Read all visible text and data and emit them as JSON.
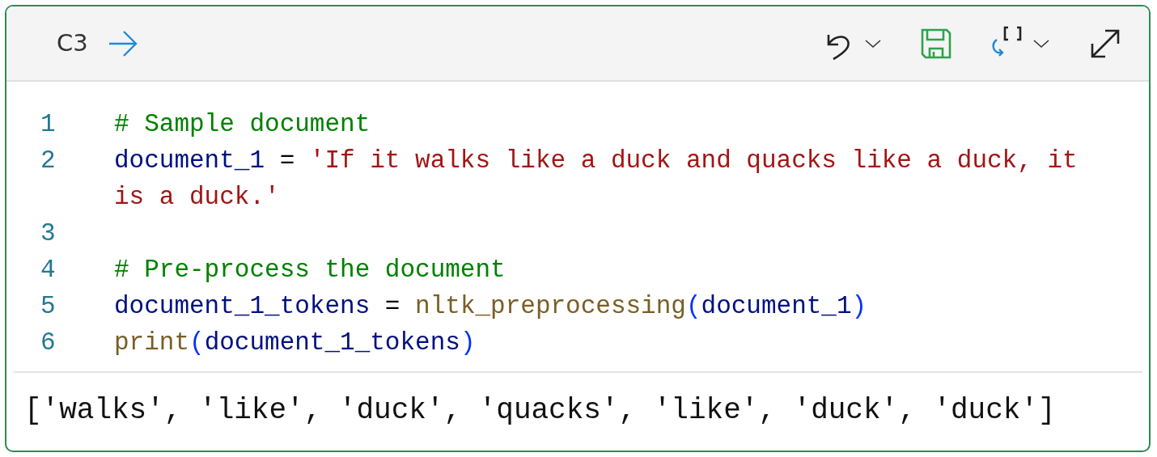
{
  "cell": {
    "label": "C3"
  },
  "code_lines": [
    {
      "number": "1",
      "tokens": [
        {
          "kind": "comment",
          "text": "# Sample document"
        }
      ]
    },
    {
      "number": "2",
      "tokens": [
        {
          "kind": "variable",
          "text": "document_1"
        },
        {
          "kind": "plain",
          "text": " = "
        },
        {
          "kind": "string",
          "text": "'If it walks like a duck and quacks like a duck, it is a duck.'"
        }
      ]
    },
    {
      "number": "3"
    },
    {
      "number": "4",
      "tokens": [
        {
          "kind": "comment",
          "text": "# Pre-process the document"
        }
      ]
    },
    {
      "number": "5",
      "tokens": [
        {
          "kind": "variable",
          "text": "document_1_tokens"
        },
        {
          "kind": "plain",
          "text": " = "
        },
        {
          "kind": "function",
          "text": "nltk_preprocessing"
        },
        {
          "kind": "paren",
          "text": "("
        },
        {
          "kind": "variable",
          "text": "document_1"
        },
        {
          "kind": "paren",
          "text": ")"
        }
      ]
    },
    {
      "number": "6",
      "tokens": [
        {
          "kind": "function",
          "text": "print"
        },
        {
          "kind": "paren",
          "text": "("
        },
        {
          "kind": "variable",
          "text": "document_1_tokens"
        },
        {
          "kind": "paren",
          "text": ")"
        }
      ]
    }
  ],
  "output": "['walks', 'like', 'duck', 'quacks', 'like', 'duck', 'duck']"
}
